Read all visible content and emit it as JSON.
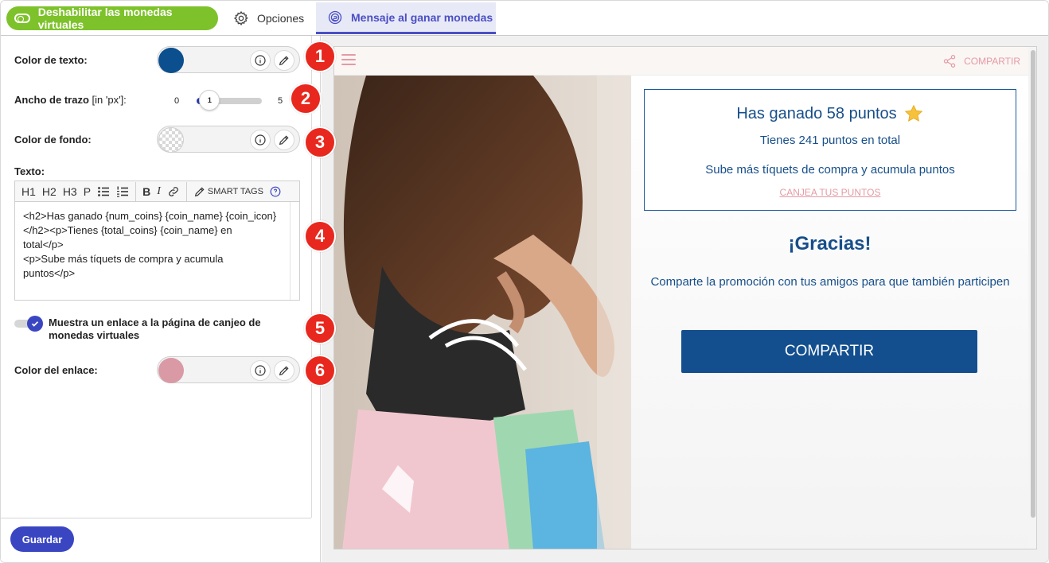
{
  "topbar": {
    "disable_label": "Deshabilitar las monedas virtuales",
    "options_tab": "Opciones",
    "message_tab": "Mensaje al ganar monedas"
  },
  "colors": {
    "green": "#7dc22a",
    "accent": "#3a46c1",
    "text_color_swatch": "#0b4f8f",
    "link_color_swatch": "#d99aa5",
    "marker": "#e8281e",
    "brand_blue": "#134f8f"
  },
  "form": {
    "text_color_label": "Color de texto:",
    "stroke_label": "Ancho de trazo",
    "stroke_unit": "[in 'px']:",
    "stroke_min": "0",
    "stroke_max": "5",
    "stroke_value": "1",
    "bg_color_label": "Color de fondo:",
    "text_label": "Texto:",
    "toolbar": {
      "h1": "H1",
      "h2": "H2",
      "h3": "H3",
      "p": "P",
      "bold": "B",
      "italic": "I",
      "smart_tags": "SMART TAGS"
    },
    "editor_content": "<h2>Has ganado {num_coins} {coin_name} {coin_icon}\n</h2><p>Tienes {total_coins} {coin_name} en\ntotal</p>\n<p>Sube más tíquets de compra y acumula\npuntos</p>",
    "show_link_label": "Muestra un enlace a la página de canjeo de monedas virtuales",
    "link_color_label": "Color del enlace:",
    "save": "Guardar"
  },
  "markers": [
    "1",
    "2",
    "3",
    "4",
    "5",
    "6"
  ],
  "preview": {
    "share_top": "COMPARTIR",
    "heading": "Has ganado 58 puntos",
    "total": "Tienes 241 puntos en total",
    "upload": "Sube más tíquets de compra y acumula puntos",
    "redeem": "CANJEA TUS PUNTOS",
    "thanks": "¡Gracias!",
    "share_text": "Comparte la promoción con tus amigos para que también participen",
    "share_button": "COMPARTIR"
  }
}
